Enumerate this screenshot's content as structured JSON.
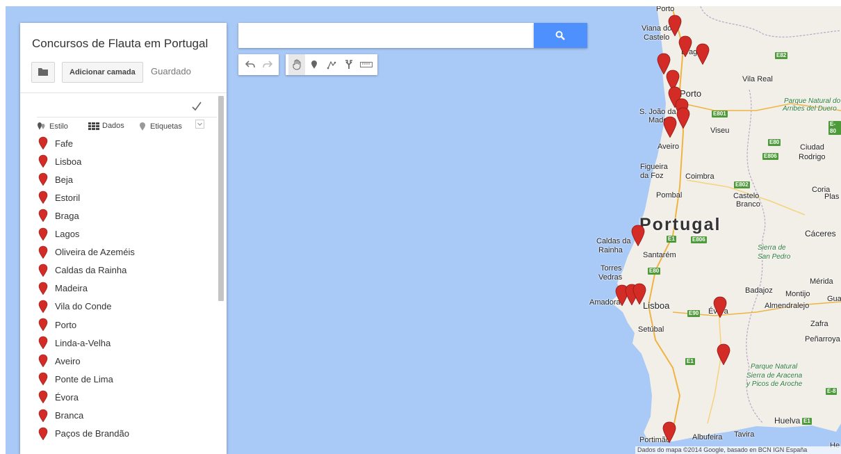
{
  "panel": {
    "title": "Concursos de Flauta em Portugal",
    "add_layer_label": "Adicionar camada",
    "saved_label": "Guardado",
    "tools": {
      "style_label": "Estilo",
      "data_label": "Dados",
      "labels_label": "Etiquetas"
    },
    "items": [
      "Fafe",
      "Lisboa",
      "Beja",
      "Estoril",
      "Braga",
      "Lagos",
      "Oliveira de Azeméis",
      "Caldas da Rainha",
      "Madeira",
      "Vila do Conde",
      "Porto",
      "Linda-a-Velha",
      "Aveiro",
      "Ponte de Lima",
      "Évora",
      "Branca",
      "Paços de Brandão"
    ]
  },
  "search": {
    "value": "",
    "placeholder": ""
  },
  "toolbar": [
    "undo-icon",
    "redo-icon",
    "hand-icon",
    "marker-icon",
    "draw-line-icon",
    "directions-icon",
    "ruler-icon"
  ],
  "colors": {
    "water": "#a9c9f6",
    "land": "#f2efe9",
    "pin": "#d32b26",
    "search_button": "#4d90fe",
    "road_badge": "#4c9a3a"
  },
  "map": {
    "country": "Portugal",
    "places": {
      "porto_top": "Porto",
      "viana": "Viana do",
      "castelo": "Castelo",
      "braga": "Braga",
      "vila_real": "Vila Real",
      "porto": "Porto",
      "sjoao": "S. João da",
      "madeira": "Madeira",
      "viseu": "Viseu",
      "aveiro": "Aveiro",
      "figueira": "Figueira",
      "da_foz": "da Foz",
      "coimbra": "Coimbra",
      "pombal": "Pombal",
      "castelo2": "Castelo",
      "branco": "Branco",
      "ciudad": "Ciudad",
      "rodrigo": "Rodrigo",
      "coria": "Coria",
      "plas": "Plas",
      "caceres": "Cáceres",
      "caldas_da": "Caldas da",
      "rainha": "Rainha",
      "santarem": "Santarém",
      "torres": "Torres",
      "vedras": "Vedras",
      "sierra_de": "Sierra de",
      "san_pedro": "San Pedro",
      "merida": "Mérida",
      "amadora": "Amadora",
      "lisboa": "Lisboa",
      "badajoz": "Badajoz",
      "montijo": "Montijo",
      "gua": "Gua",
      "almendralejo": "Almendralejo",
      "evora": "Évora",
      "setubal": "Setúbal",
      "zafra": "Zafra",
      "penarroya": "Peñarroya",
      "pn1": "Parque Natural",
      "pn2": "Sierra de Aracena",
      "pn3": "y Picos de Aroche",
      "pnd1": "Parque Natural do",
      "pnd2": "Arribes del Duero",
      "huelva": "Huelva",
      "portimao": "Portimão",
      "albufeira": "Albufeira",
      "tavira": "Tavira",
      "he": "He"
    },
    "roads": {
      "e82": "E82",
      "e801": "E801",
      "e80": "E80",
      "e806": "E806",
      "e802": "E802",
      "e806b": "E806",
      "e1": "E1",
      "e80b": "E80",
      "e90": "E90",
      "e1b": "E1",
      "e1c": "E1",
      "e8": "E-80",
      "e8b": "E-8"
    },
    "attribution": "Dados do mapa ©2014 Google, basado en BCN IGN España"
  }
}
